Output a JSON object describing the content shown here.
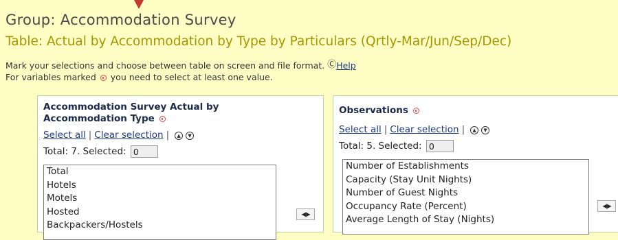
{
  "header": {
    "group_title": "Group: Accommodation Survey",
    "table_title": "Table: Actual by Accommodation by Type by Particulars (Qrtly-Mar/Jun/Sep/Dec)"
  },
  "instructions": {
    "line1": "Mark your selections and choose between table on screen and file format.",
    "help_label": "Help",
    "line2_prefix": "For variables marked",
    "line2_suffix": "you need to select at least one value."
  },
  "panels": {
    "left": {
      "title": "Accommodation Survey Actual by Accommodation Type",
      "select_all": "Select all",
      "clear_selection": "Clear selection",
      "total_label": "Total: 7. Selected:",
      "selected_value": "0",
      "items": [
        "Total",
        "Hotels",
        "Motels",
        "Hosted",
        "Backpackers/Hostels"
      ]
    },
    "right": {
      "title": "Observations",
      "select_all": "Select all",
      "clear_selection": "Clear selection",
      "total_label": "Total: 5. Selected:",
      "selected_value": "0",
      "items": [
        "Number of Establishments",
        "Capacity (Stay Unit Nights)",
        "Number of Guest Nights",
        "Occupancy Rate (Percent)",
        "Average Length of Stay (Nights)"
      ]
    }
  },
  "icons": {
    "required": "required-marker-icon",
    "help": "help-icon",
    "sort_ascending": "sort-ascending-icon",
    "sort_descending": "sort-descending-icon",
    "move": "move-arrows-icon"
  },
  "colors": {
    "background": "#fdfdc4",
    "table_title": "#a69400",
    "required": "#e8403d",
    "link": "#1a3a8a",
    "panel_border": "#b8d6a4"
  }
}
